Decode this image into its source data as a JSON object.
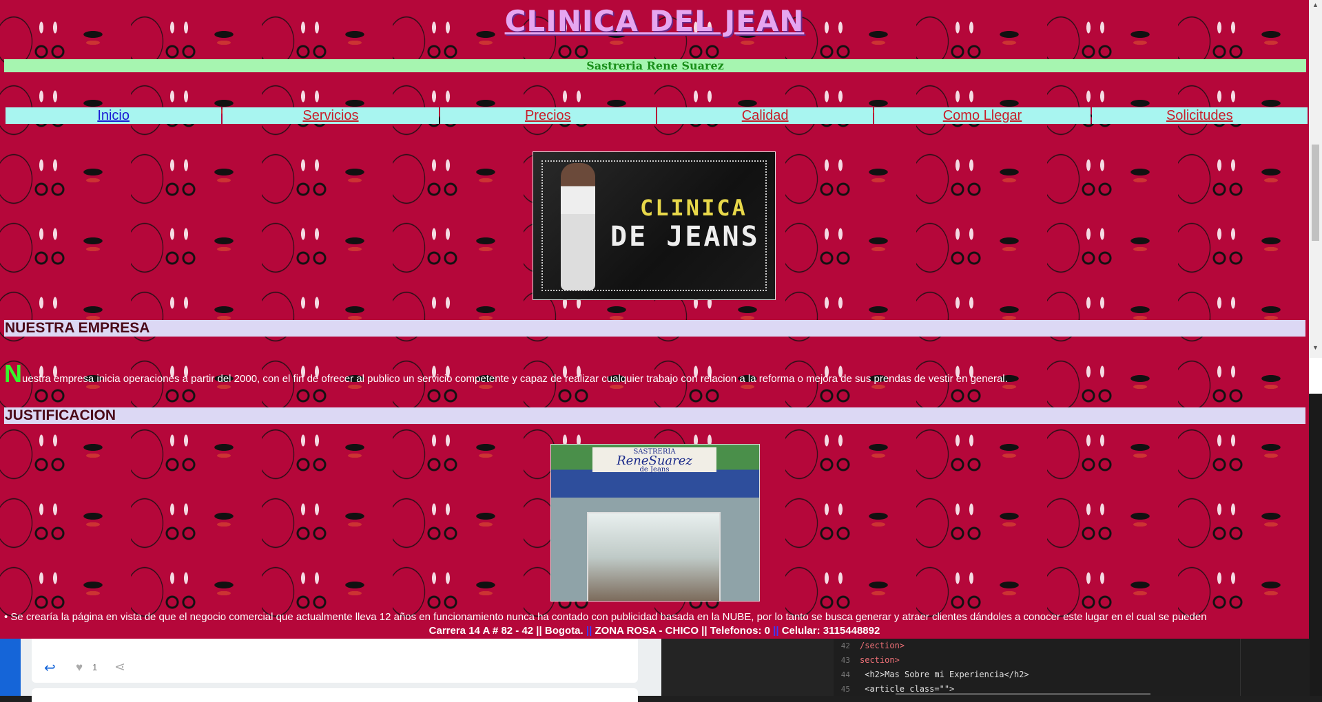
{
  "site": {
    "title": "CLINICA DEL JEAN",
    "subtitle": "Sastreria Rene Suarez",
    "nav": [
      {
        "label": "Inicio"
      },
      {
        "label": "Servicios"
      },
      {
        "label": "Precios"
      },
      {
        "label": "Calidad"
      },
      {
        "label": "Como Llegar"
      },
      {
        "label": "Solicitudes"
      }
    ],
    "logo_image": {
      "line1": "CLINICA",
      "line2": "DE JEANS"
    },
    "sections": [
      {
        "heading": "NUESTRA EMPRESA"
      },
      {
        "heading": "JUSTIFICACION"
      }
    ],
    "intro": {
      "initial": "N",
      "text": "uestra empresa inicia operaciones a partir del 2000, con el fin de ofrecer al publico un servicio competente y capaz de realizar cualquier trabajo con relacion a la reforma o mejora de sus prendas de vestir en general."
    },
    "shop_image": {
      "sign_top": "SASTRERIA",
      "sign_name": "ReneSuarez",
      "sign_side": "de Jeans"
    },
    "body_text": "• Se crearía la página en vista de que el negocio comercial que actualmente lleva 12 años en funcionamiento nunca ha contado con publicidad basada en la NUBE, por lo tanto se busca generar y atraer clientes dándoles a conocer este lugar en el cual se pueden",
    "footer": {
      "address": "Carrera 14 A # 82 - 42 || Bogota.",
      "sep1": "||",
      "zone": "ZONA ROSA - CHICO || Telefonos: 0",
      "sep2": "||",
      "cell": "Celular: 3115448892"
    }
  },
  "under_app": {
    "like_count": "1",
    "editor_lines": [
      {
        "num": "42",
        "text": "/section>"
      },
      {
        "num": "43",
        "text": "section>"
      },
      {
        "num": "44",
        "text": " <h2>Mas Sobre mi Experiencia</h2>"
      },
      {
        "num": "45",
        "text": " <article class=\"\">"
      }
    ]
  },
  "colors": {
    "page_bg": "#b5073a",
    "subtitle_bar": "#a6f5b0",
    "nav_bg": "#a8f5f0",
    "section_bar": "#dcd8f4",
    "accent_blue": "#1565d8"
  },
  "icons": [
    "reply-icon",
    "heart-icon",
    "share-icon",
    "scroll-up-icon",
    "scroll-down-icon"
  ]
}
